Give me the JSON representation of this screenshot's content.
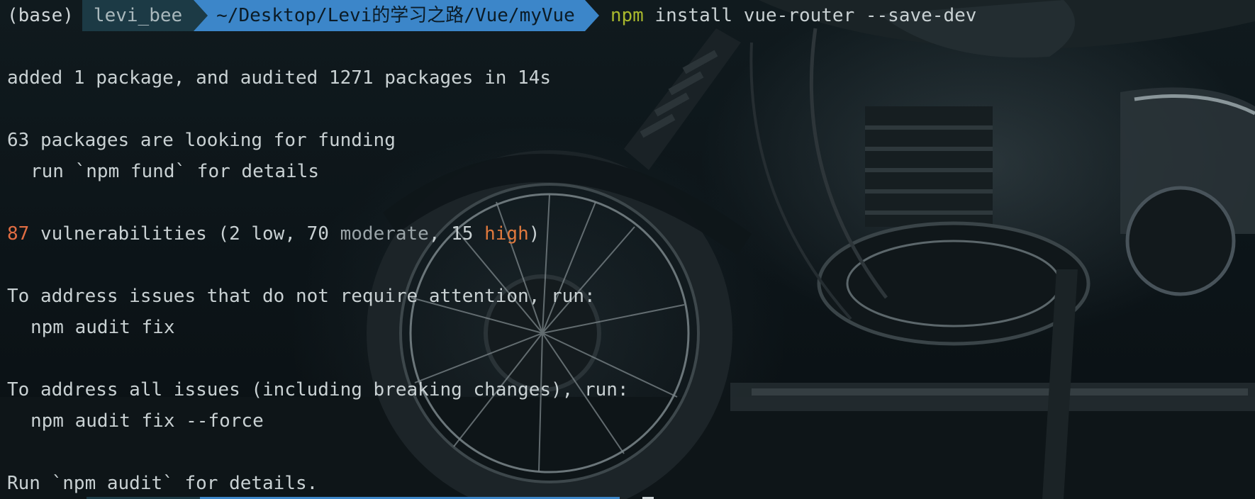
{
  "prompt": {
    "env": "(base)",
    "user": "levi_bee",
    "path": "~/Desktop/Levi的学习之路/Vue/myVue",
    "command_npm": "npm",
    "command_args": " install vue-router --save-dev"
  },
  "output": {
    "added": "added 1 package, and audited 1271 packages in 14s",
    "funding": "63 packages are looking for funding",
    "funding_hint": "run `npm fund` for details",
    "vuln_count": "87",
    "vuln_text_1": " vulnerabilities (2 low, 70 ",
    "vuln_moderate": "moderate",
    "vuln_text_2": ", 15 ",
    "vuln_high": "high",
    "vuln_text_3": ")",
    "address_1": "To address issues that do not require attention, run:",
    "fix_1": "npm audit fix",
    "address_2": "To address all issues (including breaking changes), run:",
    "fix_2": "npm audit fix --force",
    "details": "Run `npm audit` for details."
  },
  "colors": {
    "user_segment": "#1c3a45",
    "path_segment": "#3c86c9",
    "npm_command": "#a9b82d",
    "error_number": "#e06d43",
    "high_word": "#e0793d"
  }
}
